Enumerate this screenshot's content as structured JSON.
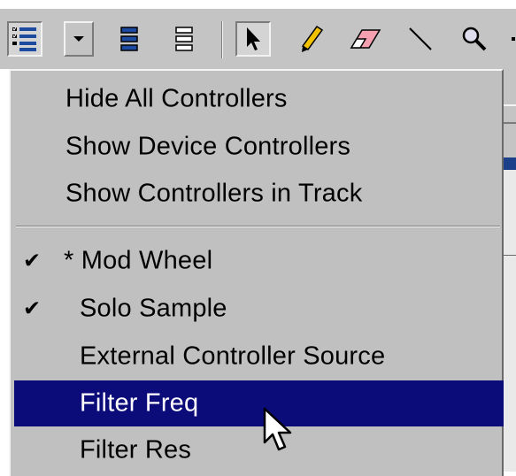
{
  "toolbar": {
    "buttons": [
      {
        "name": "controller-list-icon",
        "tooltip": ""
      },
      {
        "name": "dropdown-arrow",
        "tooltip": ""
      },
      {
        "name": "track-stack-icon-1",
        "tooltip": ""
      },
      {
        "name": "track-stack-icon-2",
        "tooltip": ""
      },
      {
        "name": "select-tool",
        "tooltip": ""
      },
      {
        "name": "pencil-tool",
        "tooltip": ""
      },
      {
        "name": "eraser-tool",
        "tooltip": ""
      },
      {
        "name": "line-tool",
        "tooltip": ""
      },
      {
        "name": "zoom-tool",
        "tooltip": ""
      }
    ]
  },
  "menu": {
    "group1": [
      {
        "label": "Hide All Controllers"
      },
      {
        "label": "Show Device Controllers"
      },
      {
        "label": "Show Controllers in Track"
      }
    ],
    "group2": [
      {
        "label": "* Mod Wheel",
        "checked": true,
        "check": "✔"
      },
      {
        "label": "Solo Sample",
        "checked": true,
        "check": "✔"
      },
      {
        "label": "External Controller Source",
        "checked": false,
        "check": ""
      },
      {
        "label": "Filter Freq",
        "checked": false,
        "check": "",
        "highlighted": true
      },
      {
        "label": "Filter Res",
        "checked": false,
        "check": ""
      }
    ]
  },
  "colors": {
    "menu_bg": "#c0c0c0",
    "highlight": "#0b0b7a",
    "toolbar_bg": "#c4c4c4"
  }
}
